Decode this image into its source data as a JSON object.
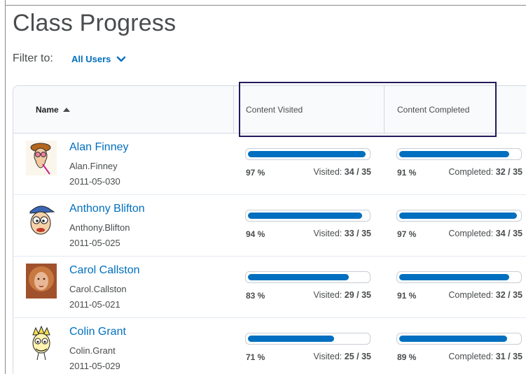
{
  "page": {
    "title": "Class Progress"
  },
  "filter": {
    "label": "Filter to:",
    "value": "All Users"
  },
  "table": {
    "headers": {
      "name": "Name",
      "visited": "Content Visited",
      "completed": "Content Completed"
    },
    "rows": [
      {
        "name": "Alan Finney",
        "login": "Alan.Finney",
        "id": "2011-05-030",
        "avatar": "cartoon-hat-avatar",
        "visited_pct": "97 %",
        "visited_label": "Visited:",
        "visited_count": "34 / 35",
        "visited_fraction": 0.97,
        "completed_pct": "91 %",
        "completed_label": "Completed:",
        "completed_count": "32 / 35",
        "completed_fraction": 0.91
      },
      {
        "name": "Anthony Blifton",
        "login": "Anthony.Blifton",
        "id": "2011-05-025",
        "avatar": "cartoon-cap-avatar",
        "visited_pct": "94 %",
        "visited_label": "Visited:",
        "visited_count": "33 / 35",
        "visited_fraction": 0.94,
        "completed_pct": "97 %",
        "completed_label": "Completed:",
        "completed_count": "34 / 35",
        "completed_fraction": 0.97
      },
      {
        "name": "Carol Callston",
        "login": "Carol.Callston",
        "id": "2011-05-021",
        "avatar": "photo-avatar",
        "visited_pct": "83 %",
        "visited_label": "Visited:",
        "visited_count": "29 / 35",
        "visited_fraction": 0.83,
        "completed_pct": "91 %",
        "completed_label": "Completed:",
        "completed_count": "32 / 35",
        "completed_fraction": 0.91
      },
      {
        "name": "Colin Grant",
        "login": "Colin.Grant",
        "id": "2011-05-029",
        "avatar": "cartoon-spiky-avatar",
        "visited_pct": "71 %",
        "visited_label": "Visited:",
        "visited_count": "25 / 35",
        "visited_fraction": 0.71,
        "completed_pct": "89 %",
        "completed_label": "Completed:",
        "completed_count": "31 / 35",
        "completed_fraction": 0.89
      }
    ]
  },
  "colors": {
    "accent": "#006fbf",
    "highlight": "#231a5c",
    "text": "#494c4e"
  }
}
